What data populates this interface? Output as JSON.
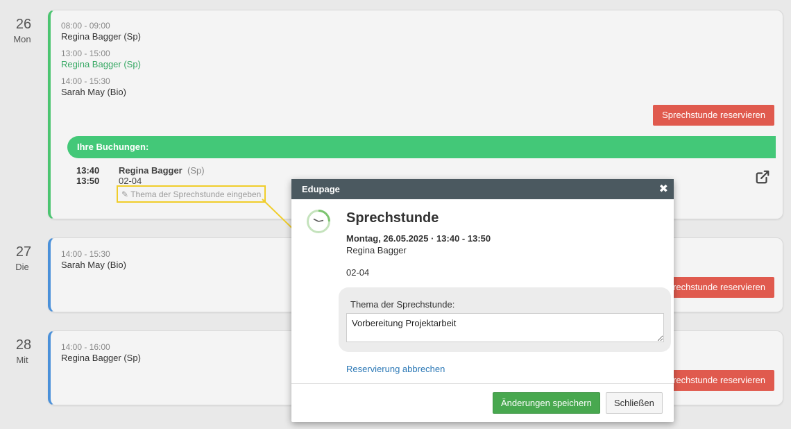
{
  "days": [
    {
      "num": "26",
      "name": "Mon",
      "slots": [
        {
          "time": "08:00 - 09:00",
          "name": "Regina Bagger (Sp)"
        },
        {
          "time": "13:00 - 15:00",
          "name": "Regina Bagger (Sp)"
        },
        {
          "time": "14:00 - 15:30",
          "name": "Sarah May (Bio)"
        }
      ],
      "reserve_label": "Sprechstunde reservieren"
    },
    {
      "num": "27",
      "name": "Die",
      "slots": [
        {
          "time": "14:00 - 15:30",
          "name": "Sarah May (Bio)"
        }
      ],
      "reserve_label": "Sprechstunde reservieren"
    },
    {
      "num": "28",
      "name": "Mit",
      "slots": [
        {
          "time": "14:00 - 16:00",
          "name": "Regina Bagger (Sp)"
        }
      ],
      "reserve_label": "Sprechstunde reservieren"
    }
  ],
  "bookings": {
    "header": "Ihre Buchungen:",
    "item": {
      "start": "13:40",
      "end": "13:50",
      "teacher": "Regina Bagger",
      "subject": "(Sp)",
      "room": "02-04",
      "topic_prompt": "Thema der Sprechstunde eingeben"
    }
  },
  "modal": {
    "header": "Edupage",
    "close_glyph": "✖",
    "title": "Sprechstunde",
    "date": "Montag, 26.05.2025 · 13:40 - 13:50",
    "teacher": "Regina Bagger",
    "room": "02-04",
    "topic_label": "Thema der Sprechstunde:",
    "topic_value": "Vorbereitung Projektarbeit",
    "cancel_label": "Reservierung abbrechen",
    "save_label": "Änderungen speichern",
    "close_label": "Schließen"
  },
  "colors": {
    "booked_green": "#43c878",
    "reserve_red": "#e05a4e",
    "highlight_yellow": "#f0cd2a",
    "modal_header": "#4b5960"
  },
  "icons": {
    "edit": "pencil-icon",
    "external": "external-link-icon",
    "clock": "clock-icon",
    "close": "close-icon"
  }
}
